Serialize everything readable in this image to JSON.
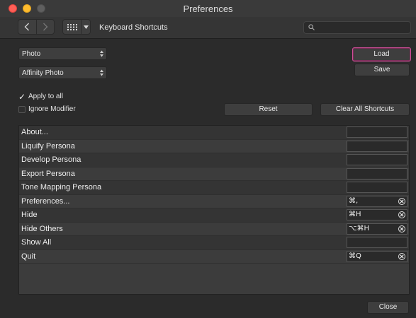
{
  "window": {
    "title": "Preferences"
  },
  "toolbar": {
    "title": "Keyboard Shortcuts",
    "search_placeholder": ""
  },
  "selects": {
    "application": "Photo",
    "context": "Affinity Photo"
  },
  "buttons": {
    "load": "Load",
    "save": "Save",
    "reset": "Reset",
    "clear_all": "Clear All Shortcuts",
    "close": "Close"
  },
  "options": {
    "apply_to_all": {
      "label": "Apply to all",
      "checked": true
    },
    "ignore_modifier": {
      "label": "Ignore Modifier",
      "checked": false
    }
  },
  "shortcuts": [
    {
      "label": "About...",
      "key": ""
    },
    {
      "label": "Liquify Persona",
      "key": ""
    },
    {
      "label": "Develop Persona",
      "key": ""
    },
    {
      "label": "Export Persona",
      "key": ""
    },
    {
      "label": "Tone Mapping Persona",
      "key": ""
    },
    {
      "label": "Preferences...",
      "key": "⌘,"
    },
    {
      "label": "Hide",
      "key": "⌘H"
    },
    {
      "label": "Hide Others",
      "key": "⌥⌘H"
    },
    {
      "label": "Show All",
      "key": ""
    },
    {
      "label": "Quit",
      "key": "⌘Q"
    }
  ],
  "colors": {
    "accent": "#d24f9a",
    "background": "#2b2b2b"
  },
  "icons": [
    "back-arrow-icon",
    "forward-arrow-icon",
    "grid-icon",
    "chevron-down-icon",
    "search-icon",
    "clear-icon",
    "checkmark-icon",
    "stepper-arrows-icon"
  ]
}
